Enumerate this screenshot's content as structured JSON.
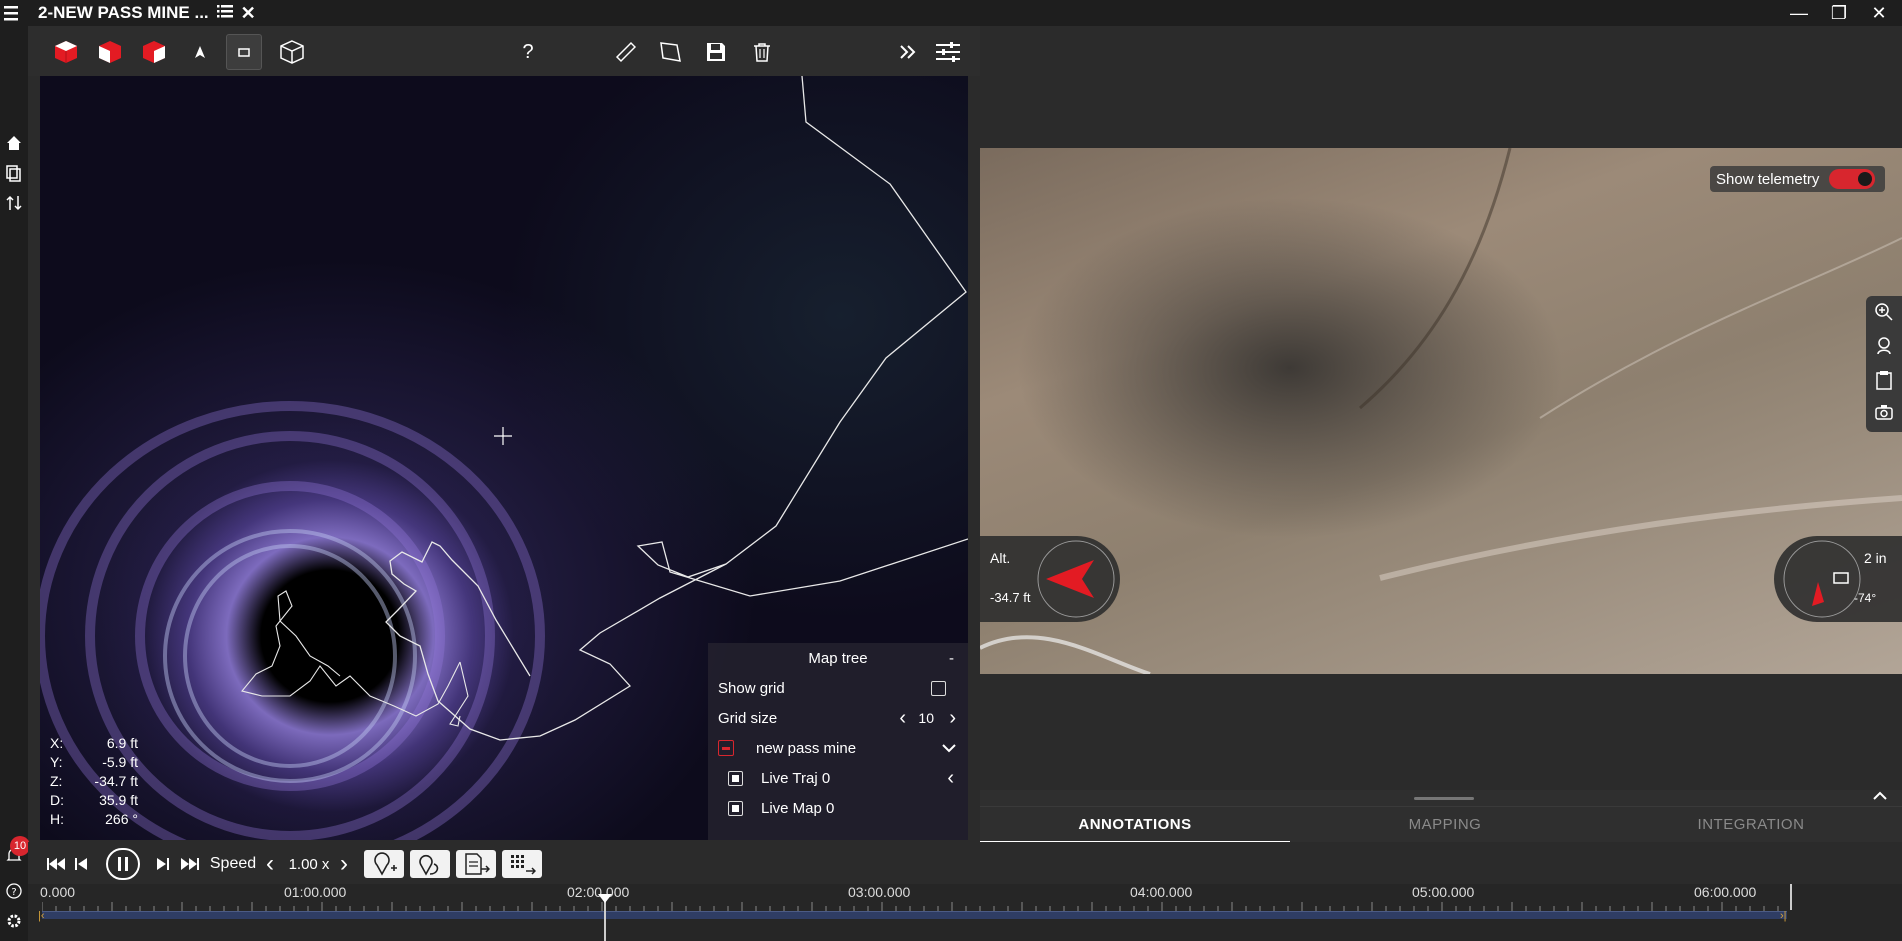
{
  "titlebar": {
    "tab_title": "2-NEW PASS MINE ...",
    "minimize": "—",
    "maximize": "❐",
    "close": "✕"
  },
  "toolbar": {
    "help_label": "?",
    "icons": [
      "cube-red-icon",
      "cube-red-icon",
      "cube-red-icon",
      "north-arrow-icon",
      "top-view-icon",
      "cube-outline-icon",
      "help-icon",
      "ruler-icon",
      "polygon-icon",
      "save-icon",
      "trash-icon",
      "expand-icon",
      "settings-sliders-icon"
    ]
  },
  "left_rail": {
    "icons": [
      "menu-icon",
      "home-icon",
      "copy-icon",
      "sort-icon",
      "notification-icon",
      "help-icon",
      "gear-icon"
    ],
    "notification_count": "10"
  },
  "coordinates": {
    "rows": [
      {
        "label": "X:",
        "value": "6.9 ft"
      },
      {
        "label": "Y:",
        "value": "-5.9 ft"
      },
      {
        "label": "Z:",
        "value": "-34.7 ft"
      },
      {
        "label": "D:",
        "value": "35.9 ft"
      },
      {
        "label": "H:",
        "value": "266 °"
      }
    ]
  },
  "map_tree": {
    "title": "Map tree",
    "collapse": "-",
    "show_grid": "Show grid",
    "grid_size_label": "Grid size",
    "grid_size_value": "10",
    "project": "new pass mine",
    "layers": [
      "Live Traj 0",
      "Live Map 0"
    ]
  },
  "video": {
    "show_telemetry": "Show telemetry",
    "telemetry_enabled": true,
    "alt_label": "Alt.",
    "alt_value": "-34.7 ft",
    "camera_distance": "2 in",
    "camera_angle": "-74°"
  },
  "bottom_tabs": {
    "tabs": [
      "ANNOTATIONS",
      "MAPPING",
      "INTEGRATION"
    ],
    "active": "ANNOTATIONS"
  },
  "playback": {
    "speed_label": "Speed",
    "speed_value": "1.00 x"
  },
  "timeline": {
    "labels": [
      "0.000",
      "01:00.000",
      "02:00.000",
      "03:00.000",
      "04:00.000",
      "05:00.000",
      "06:00.000"
    ]
  },
  "colors": {
    "accent": "#d8262e",
    "tab_active_underline": "#ffffff",
    "track": "#2f3d64"
  }
}
